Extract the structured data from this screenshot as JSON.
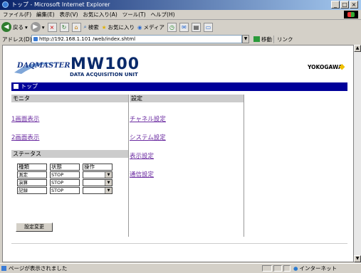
{
  "window": {
    "title": "トップ - Microsoft Internet Explorer",
    "win_buttons": [
      "_",
      "□",
      "×"
    ]
  },
  "menu": [
    "ファイル(F)",
    "編集(E)",
    "表示(V)",
    "お気に入り(A)",
    "ツール(T)",
    "ヘルプ(H)"
  ],
  "toolbar": {
    "back": "戻る",
    "search": "検索",
    "favorites": "お気に入り",
    "media": "メディア"
  },
  "address": {
    "label": "アドレス(D)",
    "url": "http://192.168.1.101 /web/index.shtml",
    "go": "移動",
    "links": "リンク"
  },
  "page": {
    "brand": {
      "daq": "DAQMASTER",
      "model": "MW100",
      "subtitle": "DATA ACQUISITION UNIT",
      "maker": "YOKOGAWA"
    },
    "title_bar": "トップ",
    "monitor": {
      "heading": "モニタ",
      "links": [
        "1画面表示",
        "2画面表示"
      ]
    },
    "status": {
      "heading": "ステータス",
      "columns": [
        "種類",
        "状態",
        "操作"
      ],
      "rows": [
        {
          "type": "測定",
          "state": "STOP"
        },
        {
          "type": "演算",
          "state": "STOP"
        },
        {
          "type": "記録",
          "state": "STOP"
        }
      ],
      "button": "設定変更"
    },
    "settings": {
      "heading": "設定",
      "links": [
        "チャネル設定",
        "システム設定",
        "表示設定",
        "通信設定"
      ]
    }
  },
  "statusbar": {
    "text": "ページが表示されました",
    "zone": "インターネット"
  }
}
